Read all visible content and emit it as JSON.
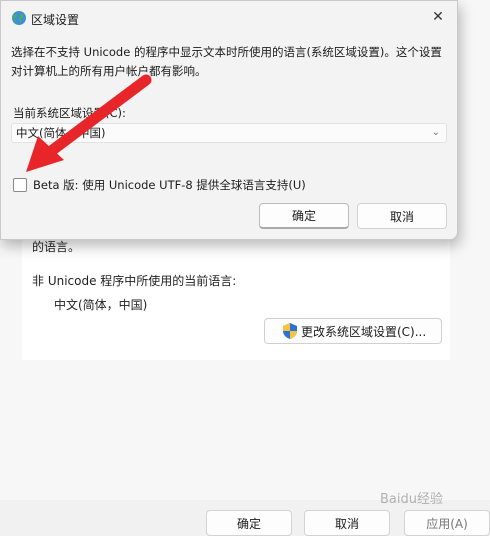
{
  "dialog": {
    "title": "区域设置",
    "description": "选择在不支持 Unicode 的程序中显示文本时所使用的语言(系统区域设置)。这个设置对计算机上的所有用户帐户都有影响。",
    "select_label": "当前系统区域设置(C):",
    "select_value": "中文(简体，中国)",
    "beta_label": "Beta 版: 使用 Unicode UTF-8 提供全球语言支持(U)",
    "beta_checked": false,
    "ok_label": "确定",
    "cancel_label": "取消"
  },
  "parent": {
    "partial_text": "的语言。",
    "non_unicode_label": "非 Unicode 程序中所使用的当前语言:",
    "non_unicode_value": "中文(简体，中国)",
    "change_locale_label": "更改系统区域设置(C)...",
    "ok_label": "确定",
    "cancel_label": "取消",
    "apply_label": "应用(A)"
  },
  "annotation": {
    "arrow_color": "#e8262a"
  },
  "watermark": "Baidu经验"
}
